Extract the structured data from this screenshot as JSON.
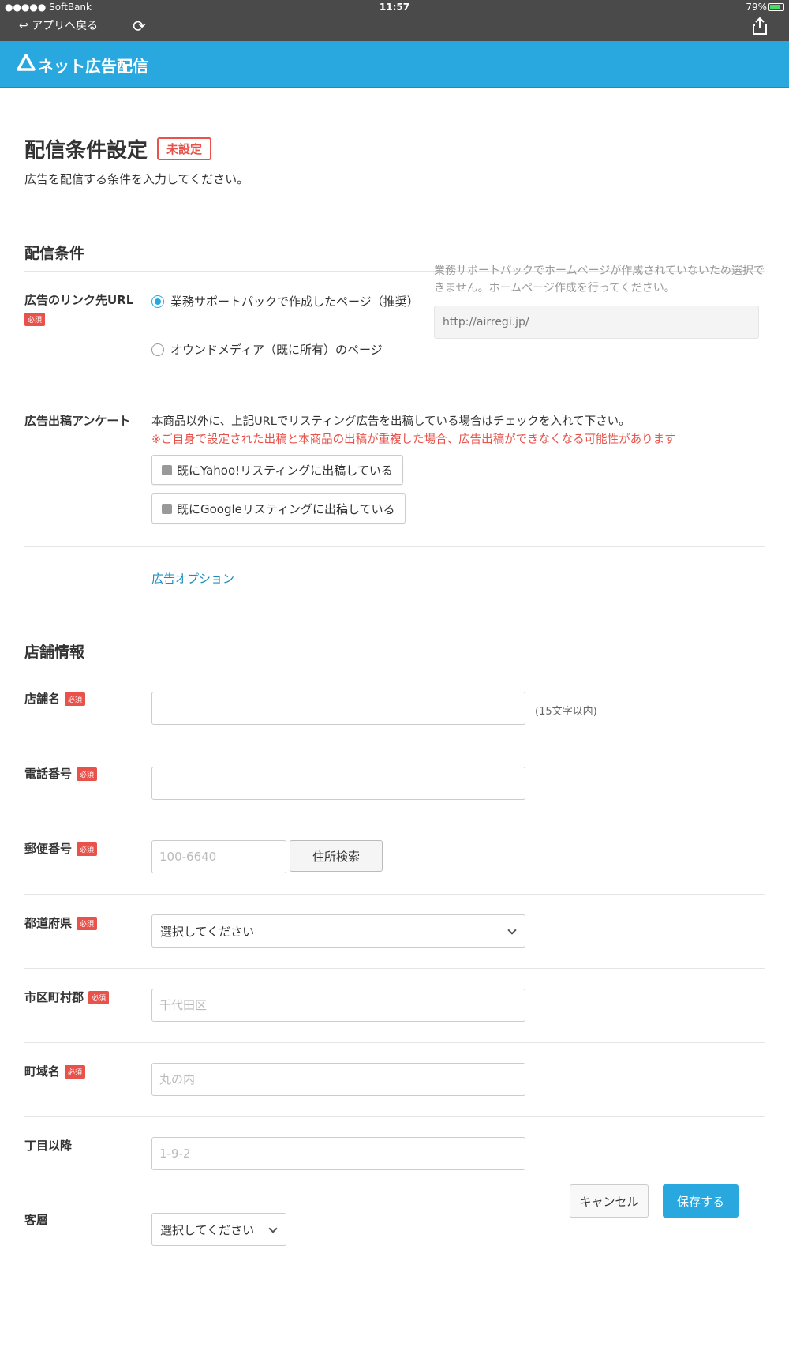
{
  "status_bar": {
    "carrier": "●●●●● SoftBank",
    "time": "11:57",
    "battery": "79%",
    "battery_level": 0.79
  },
  "nav_bar": {
    "back_label": "アプリへ戻る",
    "reload_icon": "reload-icon",
    "share_icon": "share-icon"
  },
  "header": {
    "logo_icon": "triangle-logo-icon",
    "title": "ネット広告配信"
  },
  "page": {
    "title": "配信条件設定",
    "status_badge": "未設定",
    "description": "広告を配信する条件を入力してください。"
  },
  "delivery_section": {
    "title": "配信条件",
    "link_url": {
      "label": "広告のリンク先URL",
      "required": "必須",
      "option1": "業務サポートパックで作成したページ（推奨）",
      "option2": "オウンドメディア（既に所有）のページ",
      "note": "業務サポートパックでホームページが作成されていないため選択できません。ホームページ作成を行ってください。",
      "url_placeholder": "http://airregi.jp/"
    },
    "survey": {
      "label": "広告出稿アンケート",
      "description": "本商品以外に、上記URLでリスティング広告を出稿している場合はチェックを入れて下さい。",
      "warning": "※ご自身で設定された出稿と本商品の出稿が重複した場合、広告出稿ができなくなる可能性があります",
      "yahoo": "既にYahoo!リスティングに出稿している",
      "google": "既にGoogleリスティングに出稿している"
    },
    "option_link": "広告オプション"
  },
  "store_section": {
    "title": "店舗情報",
    "required": "必須",
    "store_name": {
      "label": "店舗名",
      "hint": "(15文字以内)"
    },
    "phone": {
      "label": "電話番号"
    },
    "postal": {
      "label": "郵便番号",
      "placeholder": "100-6640",
      "search_button": "住所検索"
    },
    "prefecture": {
      "label": "都道府県",
      "value": "選択してください"
    },
    "city": {
      "label": "市区町村郡",
      "placeholder": "千代田区"
    },
    "town": {
      "label": "町域名",
      "placeholder": "丸の内"
    },
    "street": {
      "label": "丁目以降",
      "placeholder": "1-9-2"
    },
    "customer": {
      "label": "客層",
      "value": "選択してください"
    }
  },
  "footer": {
    "cancel": "キャンセル",
    "save": "保存する"
  },
  "colors": {
    "accent": "#29a8e0",
    "required": "#e8524a",
    "link": "#1a8cc0"
  }
}
